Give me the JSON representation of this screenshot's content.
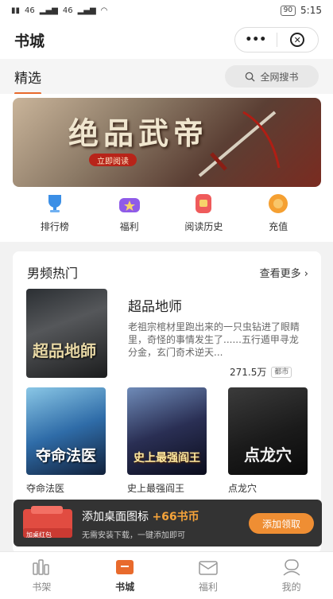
{
  "statusbar": {
    "signal_1": "46",
    "signal_2": "46",
    "battery": "90",
    "time": "5:15"
  },
  "header": {
    "title": "书城",
    "more_icon": "ellipsis-icon",
    "close_icon": "close-circle-icon"
  },
  "tabs": {
    "active": "精选",
    "search_placeholder": "全网搜书"
  },
  "banner": {
    "title": "绝品武帝",
    "button": "立即阅读"
  },
  "quick_links": [
    {
      "label": "排行榜",
      "icon": "trophy-icon",
      "color": "#3b8fe6"
    },
    {
      "label": "福利",
      "icon": "gift-star-icon",
      "color": "#8f5be8"
    },
    {
      "label": "阅读历史",
      "icon": "history-icon",
      "color": "#ef5b5b"
    },
    {
      "label": "充值",
      "icon": "coin-icon",
      "color": "#f5a032"
    }
  ],
  "section": {
    "title": "男频热门",
    "more": "查看更多",
    "featured": {
      "title": "超品地师",
      "cover_text": "超品地師",
      "description": "老祖宗棺材里跑出来的一只虫钻进了眼睛里，奇怪的事情发生了......五行遁甲寻龙分金，玄门奇术逆天...",
      "words": "271.5万",
      "tag": "都市"
    },
    "books": [
      {
        "title": "夺命法医",
        "cover_text": "夺命法医"
      },
      {
        "title": "史上最强阎王",
        "cover_text": "史上最强阎王"
      },
      {
        "title": "点龙穴",
        "cover_text": "点龙穴"
      }
    ]
  },
  "toast": {
    "badge": "加桌红包",
    "title": "添加桌面图标",
    "reward": "+66书币",
    "subtitle": "无需安装下载，一键添加即可",
    "button": "添加领取"
  },
  "tabbar": [
    {
      "label": "书架",
      "icon": "bookshelf-icon"
    },
    {
      "label": "书城",
      "icon": "bookstore-icon",
      "active": true
    },
    {
      "label": "福利",
      "icon": "envelope-gift-icon"
    },
    {
      "label": "我的",
      "icon": "profile-icon"
    }
  ],
  "colors": {
    "accent": "#e86a2c",
    "toast_button": "#ef8a2b"
  }
}
